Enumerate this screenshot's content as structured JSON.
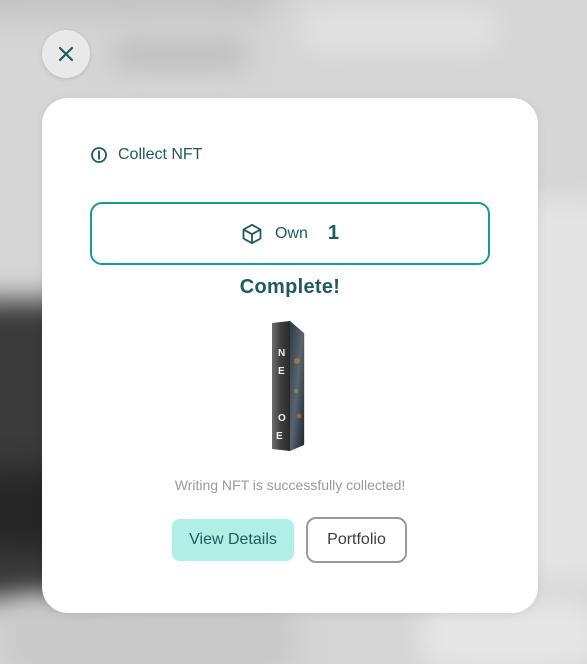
{
  "modal": {
    "header_label": "Collect NFT",
    "own_label": "Own",
    "own_count": "1",
    "status_title": "Complete!",
    "book_cover_text": [
      "N",
      "E",
      "O",
      "E"
    ],
    "message": "Writing NFT is successfully collected!",
    "view_details_label": "View Details",
    "portfolio_label": "Portfolio"
  },
  "icons": {
    "close": "close-icon",
    "info": "info-icon",
    "own": "cube-icon"
  },
  "colors": {
    "accent_text": "#1f5a5e",
    "border_accent": "#1a9a8a",
    "primary_button_bg": "#aef0e6",
    "message_text": "#9b9b9b"
  }
}
